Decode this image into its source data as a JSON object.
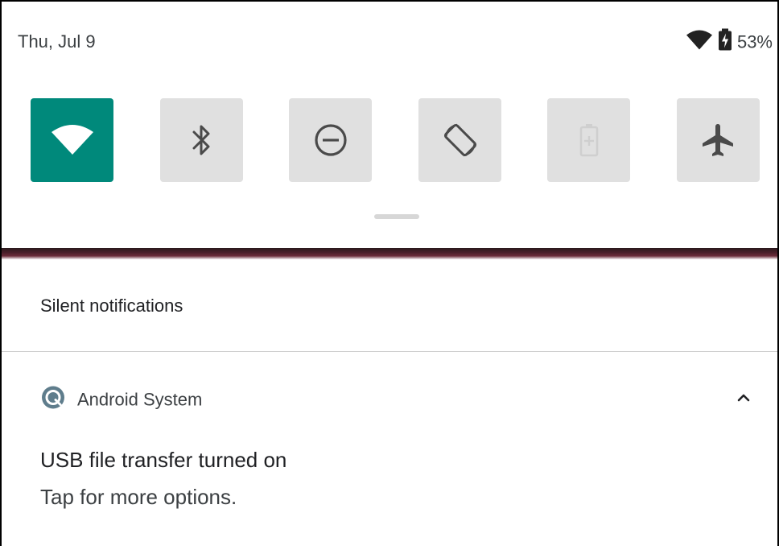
{
  "status_bar": {
    "date": "Thu, Jul 9",
    "wifi_icon": "wifi-icon",
    "battery_icon": "battery-charging-icon",
    "battery_percent": "53%"
  },
  "quick_settings": {
    "tiles": [
      {
        "name": "wifi",
        "icon": "wifi-icon",
        "state": "on"
      },
      {
        "name": "bluetooth",
        "icon": "bluetooth-icon",
        "state": "off"
      },
      {
        "name": "do-not-disturb",
        "icon": "do-not-disturb-icon",
        "state": "off"
      },
      {
        "name": "auto-rotate",
        "icon": "auto-rotate-icon",
        "state": "off"
      },
      {
        "name": "battery-saver",
        "icon": "battery-saver-icon",
        "state": "unavailable"
      },
      {
        "name": "airplane-mode",
        "icon": "airplane-icon",
        "state": "off"
      }
    ],
    "active_color": "#00897b",
    "inactive_color": "#e0e0e0"
  },
  "notifications": {
    "section_title": "Silent notifications",
    "items": [
      {
        "app_name": "Android System",
        "app_icon": "android-system-icon",
        "title": "USB file transfer turned on",
        "text": "Tap for more options.",
        "expand_icon": "chevron-up-icon"
      }
    ]
  }
}
